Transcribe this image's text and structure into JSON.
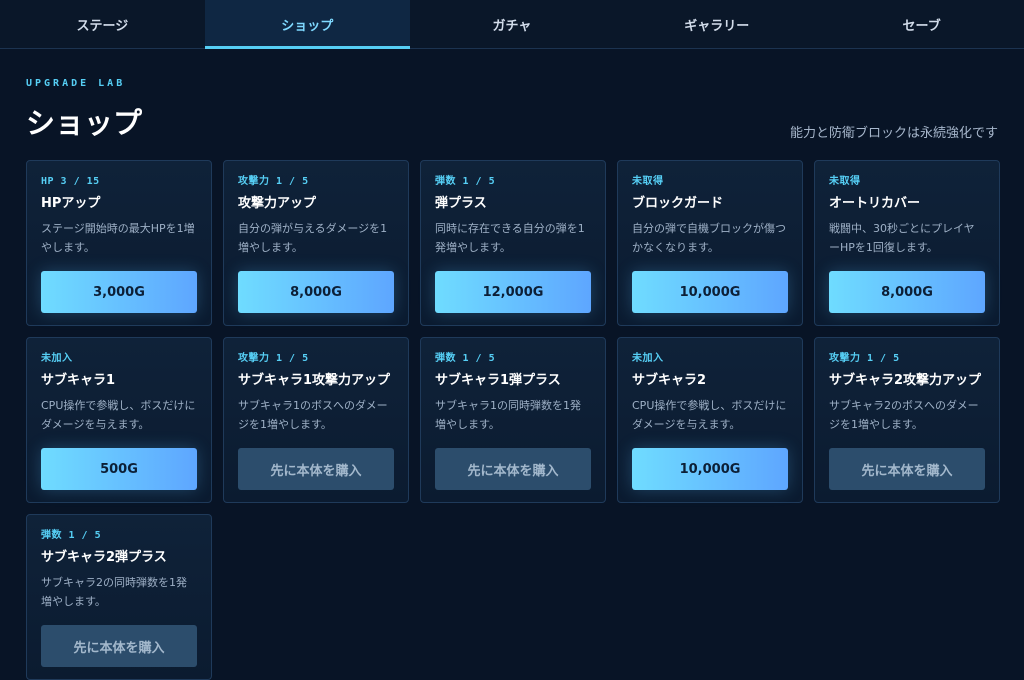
{
  "tabs": [
    {
      "label": "ステージ",
      "active": false
    },
    {
      "label": "ショップ",
      "active": true
    },
    {
      "label": "ガチャ",
      "active": false
    },
    {
      "label": "ギャラリー",
      "active": false
    },
    {
      "label": "セーブ",
      "active": false
    }
  ],
  "header": {
    "eyebrow": "UPGRADE LAB",
    "title": "ショップ",
    "subtitle": "能力と防衛ブロックは永続強化です"
  },
  "items": [
    {
      "badge": "HP 3 / 15",
      "name": "HPアップ",
      "desc": "ステージ開始時の最大HPを1増やします。",
      "button": "3,000G",
      "state": "buy"
    },
    {
      "badge": "攻撃力 1 / 5",
      "name": "攻撃力アップ",
      "desc": "自分の弾が与えるダメージを1増やします。",
      "button": "8,000G",
      "state": "buy"
    },
    {
      "badge": "弾数 1 / 5",
      "name": "弾プラス",
      "desc": "同時に存在できる自分の弾を1発増やします。",
      "button": "12,000G",
      "state": "buy"
    },
    {
      "badge": "未取得",
      "name": "ブロックガード",
      "desc": "自分の弾で自機ブロックが傷つかなくなります。",
      "button": "10,000G",
      "state": "buy"
    },
    {
      "badge": "未取得",
      "name": "オートリカバー",
      "desc": "戦闘中、30秒ごとにプレイヤーHPを1回復します。",
      "button": "8,000G",
      "state": "buy"
    },
    {
      "badge": "未加入",
      "name": "サブキャラ1",
      "desc": "CPU操作で参戦し、ボスだけにダメージを与えます。",
      "button": "500G",
      "state": "buy"
    },
    {
      "badge": "攻撃力 1 / 5",
      "name": "サブキャラ1攻撃力アップ",
      "desc": "サブキャラ1のボスへのダメージを1増やします。",
      "button": "先に本体を購入",
      "state": "locked"
    },
    {
      "badge": "弾数 1 / 5",
      "name": "サブキャラ1弾プラス",
      "desc": "サブキャラ1の同時弾数を1発増やします。",
      "button": "先に本体を購入",
      "state": "locked"
    },
    {
      "badge": "未加入",
      "name": "サブキャラ2",
      "desc": "CPU操作で参戦し、ボスだけにダメージを与えます。",
      "button": "10,000G",
      "state": "buy"
    },
    {
      "badge": "攻撃力 1 / 5",
      "name": "サブキャラ2攻撃力アップ",
      "desc": "サブキャラ2のボスへのダメージを1増やします。",
      "button": "先に本体を購入",
      "state": "locked"
    },
    {
      "badge": "弾数 1 / 5",
      "name": "サブキャラ2弾プラス",
      "desc": "サブキャラ2の同時弾数を1発増やします。",
      "button": "先に本体を購入",
      "state": "locked"
    }
  ],
  "colors": {
    "accent": "#56cff5",
    "background": "#081426",
    "buy_button_start": "#6fdcff",
    "buy_button_end": "#5ea6ff",
    "locked_button": "#2c4d6c"
  }
}
